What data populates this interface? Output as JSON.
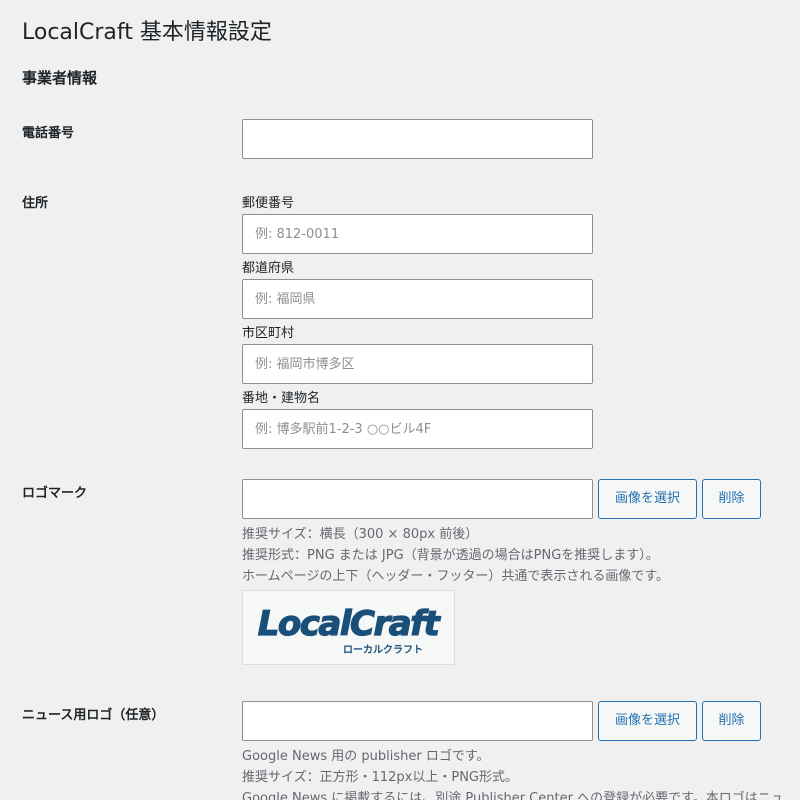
{
  "page": {
    "title": "LocalCraft 基本情報設定"
  },
  "section": {
    "heading": "事業者情報"
  },
  "phone": {
    "label": "電話番号",
    "value": "",
    "placeholder": ""
  },
  "address": {
    "label": "住所",
    "postal_label": "郵便番号",
    "postal_placeholder": "例: 812-0011",
    "prefecture_label": "都道府県",
    "prefecture_placeholder": "例: 福岡県",
    "city_label": "市区町村",
    "city_placeholder": "例: 福岡市博多区",
    "street_label": "番地・建物名",
    "street_placeholder": "例: 博多駅前1-2-3 ○○ビル4F"
  },
  "logo": {
    "label": "ロゴマーク",
    "value": "",
    "select_button": "画像を選択",
    "delete_button": "削除",
    "desc_1": "推奨サイズ：横長（300 × 80px 前後）",
    "desc_2": "推奨形式：PNG または JPG（背景が透過の場合はPNGを推奨します）。",
    "desc_3": "ホームページの上下（ヘッダー・フッター）共通で表示される画像です。",
    "preview_main_text": "LocalCraft",
    "preview_sub_text": "ローカルクラフト",
    "preview_color": "#1a4f7a"
  },
  "news_logo": {
    "label": "ニュース用ロゴ（任意）",
    "value": "",
    "select_button": "画像を選択",
    "delete_button": "削除",
    "desc_1": "Google News 用の publisher ロゴです。",
    "desc_2": "推奨サイズ：正方形・112px以上・PNG形式。",
    "desc_3": "Google News に掲載するには、別途 Publisher Center への登録が必要です。本ロゴはニュ"
  },
  "colors": {
    "background": "#f0f0f1",
    "accent": "#2271b1",
    "input_border": "#8c8f94",
    "description_text": "#646970"
  }
}
